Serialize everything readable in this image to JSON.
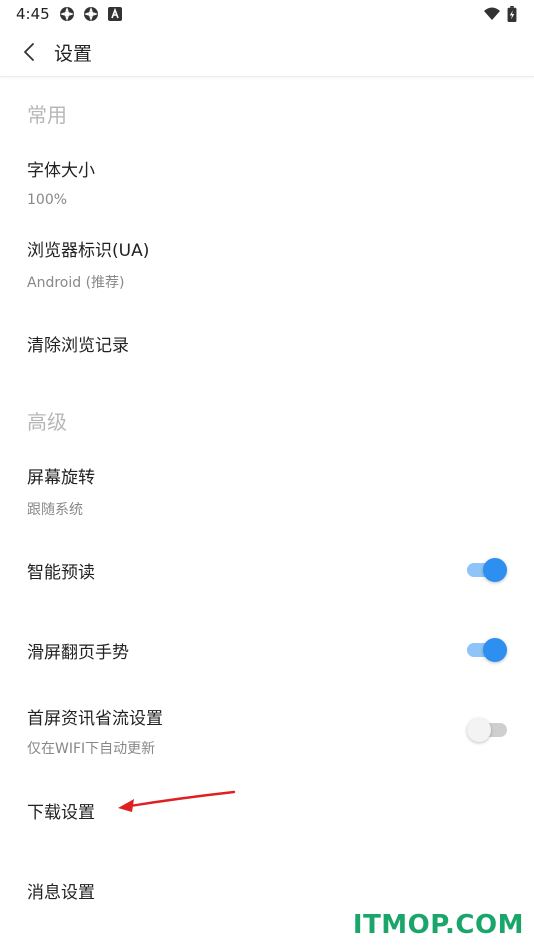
{
  "status_bar": {
    "time": "4:45",
    "icons": [
      "gear-app-icon",
      "gear-app-icon",
      "a-app-icon",
      "wifi-icon",
      "battery-icon"
    ]
  },
  "app_bar": {
    "title": "设置",
    "back_icon": "chevron-left-icon"
  },
  "sections": {
    "common": {
      "header": "常用",
      "font_size": {
        "label": "字体大小",
        "value": "100%"
      },
      "user_agent": {
        "label": "浏览器标识(UA)",
        "value": "Android (推荐)"
      },
      "clear_history": {
        "label": "清除浏览记录"
      }
    },
    "advanced": {
      "header": "高级",
      "rotation": {
        "label": "屏幕旋转",
        "value": "跟随系统"
      },
      "smart_preload": {
        "label": "智能预读",
        "enabled": true
      },
      "swipe_gesture": {
        "label": "滑屏翻页手势",
        "enabled": true
      },
      "data_saver": {
        "label": "首屏资讯省流设置",
        "value": "仅在WIFI下自动更新",
        "enabled": false
      },
      "download": {
        "label": "下载设置"
      },
      "notifications": {
        "label": "消息设置"
      }
    }
  },
  "colors": {
    "accent": "#2d8ff0",
    "accent_track": "#8ec4f7",
    "arrow": "#e02020",
    "watermark": "#1aa66b"
  },
  "watermark": "ITMOP.COM"
}
